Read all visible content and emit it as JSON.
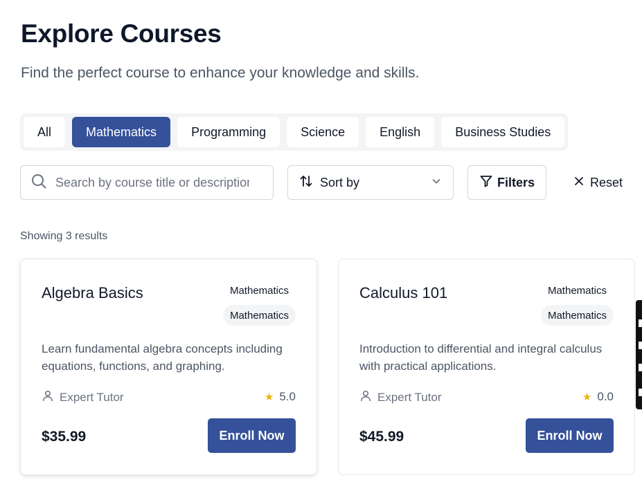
{
  "header": {
    "title": "Explore Courses",
    "subtitle": "Find the perfect course to enhance your knowledge and skills."
  },
  "tabs": [
    {
      "label": "All",
      "active": false
    },
    {
      "label": "Mathematics",
      "active": true
    },
    {
      "label": "Programming",
      "active": false
    },
    {
      "label": "Science",
      "active": false
    },
    {
      "label": "English",
      "active": false
    },
    {
      "label": "Business Studies",
      "active": false
    }
  ],
  "toolbar": {
    "search_placeholder": "Search by course title or description",
    "search_value": "",
    "sort_label": "Sort by",
    "filters_label": "Filters",
    "reset_label": "Reset"
  },
  "results": {
    "count_text": "Showing 3 results"
  },
  "courses": [
    {
      "title": "Algebra Basics",
      "category": "Mathematics",
      "category_badge": "Mathematics",
      "description": "Learn fundamental algebra concepts including equations, functions, and graphing.",
      "tutor": "Expert Tutor",
      "rating": "5.0",
      "price": "$35.99",
      "enroll_label": "Enroll Now"
    },
    {
      "title": "Calculus 101",
      "category": "Mathematics",
      "category_badge": "Mathematics",
      "description": "Introduction to differential and integral calculus with practical applications.",
      "tutor": "Expert Tutor",
      "rating": "0.0",
      "price": "$45.99",
      "enroll_label": "Enroll Now"
    }
  ],
  "colors": {
    "primary": "#34519a",
    "star": "#eab308",
    "tab_track": "#f3f4f6"
  }
}
